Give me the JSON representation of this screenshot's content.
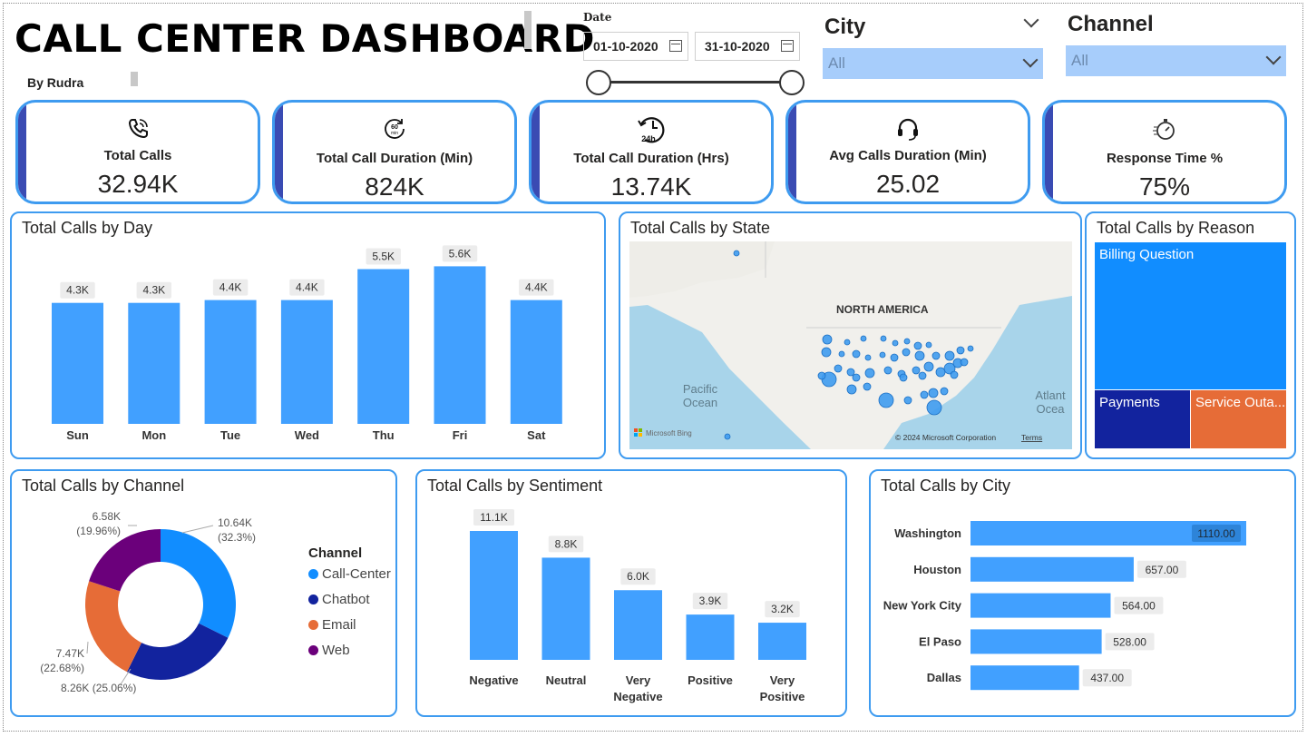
{
  "header": {
    "title": "CALL CENTER DASHBOARD",
    "byline": "By Rudra"
  },
  "date_filter": {
    "label": "Date",
    "start": "01-10-2020",
    "end": "31-10-2020",
    "range_fraction": [
      0,
      1
    ]
  },
  "filters": {
    "city": {
      "title": "City",
      "value": "All"
    },
    "channel": {
      "title": "Channel",
      "value": "All"
    }
  },
  "kpis": [
    {
      "label": "Total Calls",
      "value": "32.94K",
      "icon": "phone-icon"
    },
    {
      "label": "Total Call Duration (Min)",
      "value": "824K",
      "icon": "60-min-timer-icon"
    },
    {
      "label": "Total Call Duration (Hrs)",
      "value": "13.74K",
      "icon": "24h-clock-icon"
    },
    {
      "label": "Avg Calls Duration (Min)",
      "value": "25.02",
      "icon": "headset-icon"
    },
    {
      "label": "Response Time %",
      "value": "75%",
      "icon": "stopwatch-icon"
    }
  ],
  "panels": {
    "by_day": "Total Calls by Day",
    "by_state": "Total Calls by State",
    "by_reason": "Total Calls by Reason",
    "by_channel": "Total Calls by Channel",
    "by_sentiment": "Total Calls by Sentiment",
    "by_city": "Total Calls by City"
  },
  "map": {
    "continent_label": "NORTH AMERICA",
    "ocean_left": [
      "Pacific",
      "Ocean"
    ],
    "ocean_right": [
      "Atlant",
      "Ocea"
    ],
    "attribution": "Microsoft Bing",
    "copyright": "© 2024 Microsoft Corporation",
    "terms": "Terms"
  },
  "chart_data": [
    {
      "type": "bar",
      "title": "Total Calls by Day",
      "categories": [
        "Sun",
        "Mon",
        "Tue",
        "Wed",
        "Thu",
        "Fri",
        "Sat"
      ],
      "values": [
        4300,
        4300,
        4400,
        4400,
        5500,
        5600,
        4400
      ],
      "data_labels": [
        "4.3K",
        "4.3K",
        "4.4K",
        "4.4K",
        "5.5K",
        "5.6K",
        "4.4K"
      ],
      "color": "#41a0ff"
    },
    {
      "type": "treemap",
      "title": "Total Calls by Reason",
      "categories": [
        "Billing Question",
        "Payments",
        "Service Outa..."
      ],
      "colors": [
        "#118dff",
        "#12239e",
        "#e66c37"
      ]
    },
    {
      "type": "pie",
      "title": "Total Calls by Channel",
      "legend_title": "Channel",
      "legend_position": "right",
      "categories": [
        "Call-Center",
        "Chatbot",
        "Email",
        "Web"
      ],
      "values": [
        10640,
        8260,
        7470,
        6580
      ],
      "data_labels": [
        [
          "10.64K",
          "(32.3%)"
        ],
        [
          "8.26K (25.06%)"
        ],
        [
          "7.47K",
          "(22.68%)"
        ],
        [
          "6.58K",
          "(19.96%)"
        ]
      ],
      "colors": [
        "#118dff",
        "#12239e",
        "#e66c37",
        "#6b007b"
      ]
    },
    {
      "type": "bar",
      "title": "Total Calls by Sentiment",
      "categories": [
        [
          "Negative"
        ],
        [
          "Neutral"
        ],
        [
          "Very",
          "Negative"
        ],
        [
          "Positive"
        ],
        [
          "Very",
          "Positive"
        ]
      ],
      "values": [
        11100,
        8800,
        6000,
        3900,
        3200
      ],
      "data_labels": [
        "11.1K",
        "8.8K",
        "6.0K",
        "3.9K",
        "3.2K"
      ],
      "color": "#41a0ff"
    },
    {
      "type": "bar",
      "orientation": "horizontal",
      "title": "Total Calls by City",
      "categories": [
        "Washington",
        "Houston",
        "New York City",
        "El Paso",
        "Dallas"
      ],
      "values": [
        1110,
        657,
        564,
        528,
        437
      ],
      "data_labels": [
        "1110.00",
        "657.00",
        "564.00",
        "528.00",
        "437.00"
      ],
      "color": "#41a0ff"
    }
  ]
}
